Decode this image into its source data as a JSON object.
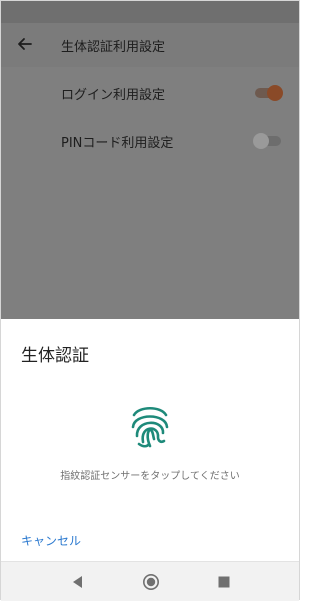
{
  "app_bar": {
    "title": "生体認証利用設定"
  },
  "settings": [
    {
      "label": "ログイン利用設定",
      "toggle_on": true
    },
    {
      "label": "PINコード利用設定",
      "toggle_on": false
    }
  ],
  "dialog": {
    "title": "生体認証",
    "hint": "指紋認証センサーをタップしてください",
    "cancel_label": "キャンセル",
    "accent_color": "#1e8a7a"
  },
  "nav": {
    "icons": [
      "back-triangle-icon",
      "home-circle-icon",
      "recents-square-icon"
    ]
  }
}
